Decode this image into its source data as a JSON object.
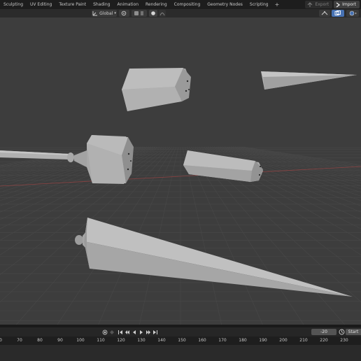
{
  "workspace_tabs": [
    "Sculpting",
    "UV Editing",
    "Texture Paint",
    "Shading",
    "Animation",
    "Rendering",
    "Compositing",
    "Geometry Nodes",
    "Scripting"
  ],
  "add_tab": "+",
  "top_right": {
    "export_label": "Export",
    "import_label": "Import"
  },
  "viewport_header": {
    "orientation": "Global"
  },
  "timeline": {
    "current_frame": "-20",
    "start_label": "Start",
    "ticks": [
      "70",
      "80",
      "90",
      "100",
      "110",
      "120",
      "130",
      "140",
      "150",
      "160",
      "170",
      "180",
      "190",
      "200",
      "210",
      "220",
      "230"
    ],
    "edge_tick": "0"
  },
  "colors": {
    "bg": "#3d3d3d",
    "grid": "#474747",
    "x_axis": "#8a4343",
    "object": "#b3b3b3",
    "topbar": "#1d1d1d",
    "accent": "#4772b3"
  }
}
